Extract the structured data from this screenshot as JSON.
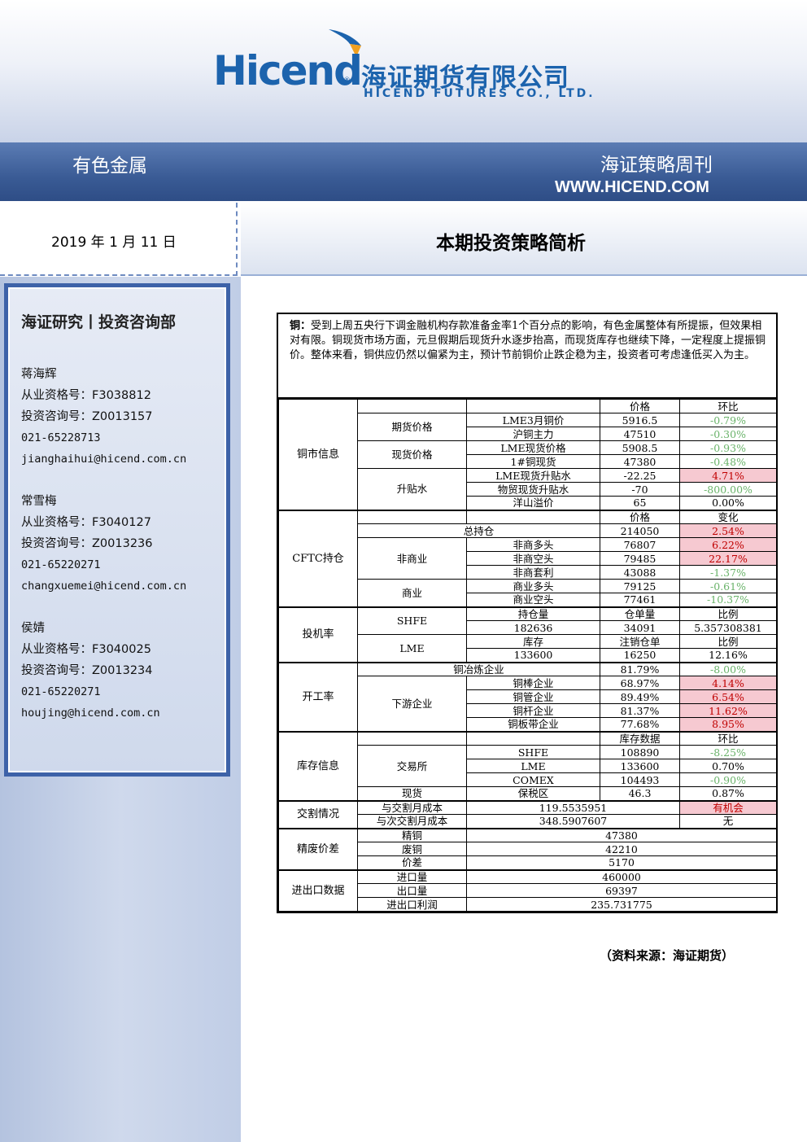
{
  "header": {
    "logo_word": "Hicend",
    "logo_tm": "®",
    "logo_cn": "海证期货有限公司",
    "logo_en": "HICEND FUTURES CO., LTD.",
    "band_left": "有色金属",
    "band_right": "海证策略周刊",
    "url": "WWW.HICEND.COM"
  },
  "date": "2019 年 1 月 11 日",
  "title": "本期投资策略简析",
  "sidebar": {
    "heading": "海证研究丨投资咨询部",
    "people": [
      {
        "name": "蒋海辉",
        "qual": "从业资格号：F3038812",
        "consult": "投资咨询号：Z0013157",
        "phone": "021-65228713",
        "email": "jianghaihui@hicend.com.cn"
      },
      {
        "name": "常雪梅",
        "qual": "从业资格号：F3040127",
        "consult": "投资咨询号：Z0013236",
        "phone": "021-65220271",
        "email": "changxuemei@hicend.com.cn"
      },
      {
        "name": "侯婧",
        "qual": "从业资格号：F3040025",
        "consult": "投资咨询号：Z0013234",
        "phone": "021-65220271",
        "email": "houjing@hicend.com.cn"
      }
    ]
  },
  "intro": {
    "label": "铜：",
    "text": "受到上周五央行下调金融机构存款准备金率1个百分点的影响，有色金属整体有所提振，但效果相对有限。铜现货市场方面，元旦假期后现货升水逐步抬高，而现货库存也继续下降，一定程度上提振铜价。整体来看，铜供应仍然以偏紧为主，预计节前铜价止跌企稳为主，投资者可考虑逢低买入为主。"
  },
  "table": {
    "copper": {
      "section": "铜市信息",
      "head_price": "价格",
      "head_change": "环比",
      "group_futures": "期货价格",
      "group_spot": "现货价格",
      "group_premium": "升贴水",
      "rows": [
        {
          "item": "LME3月铜价",
          "price": "5916.5",
          "change": "-0.79%"
        },
        {
          "item": "沪铜主力",
          "price": "47510",
          "change": "-0.30%"
        },
        {
          "item": "LME现货价格",
          "price": "5908.5",
          "change": "-0.93%"
        },
        {
          "item": "1#铜现货",
          "price": "47380",
          "change": "-0.48%"
        },
        {
          "item": "LME现货升贴水",
          "price": "-22.25",
          "change": "4.71%"
        },
        {
          "item": "物贸现货升贴水",
          "price": "-70",
          "change": "-800.00%"
        },
        {
          "item": "洋山溢价",
          "price": "65",
          "change": "0.00%"
        }
      ]
    },
    "cftc": {
      "section": "CFTC持仓",
      "head_price": "价格",
      "head_change": "变化",
      "total_label": "总持仓",
      "total_value": "214050",
      "total_change": "2.54%",
      "group_noncommercial": "非商业",
      "group_commercial": "商业",
      "rows": [
        {
          "item": "非商多头",
          "value": "76807",
          "change": "6.22%"
        },
        {
          "item": "非商空头",
          "value": "79485",
          "change": "22.17%"
        },
        {
          "item": "非商套利",
          "value": "43088",
          "change": "-1.37%"
        },
        {
          "item": "商业多头",
          "value": "79125",
          "change": "-0.61%"
        },
        {
          "item": "商业空头",
          "value": "77461",
          "change": "-10.37%"
        }
      ]
    },
    "spec": {
      "section": "投机率",
      "shfe": "SHFE",
      "lme": "LME",
      "shfe_head": [
        "持仓量",
        "仓单量",
        "比例"
      ],
      "shfe_vals": [
        "182636",
        "34091",
        "5.357308381"
      ],
      "lme_head": [
        "库存",
        "注销仓单",
        "比例"
      ],
      "lme_vals": [
        "133600",
        "16250",
        "12.16%"
      ]
    },
    "operating": {
      "section": "开工率",
      "smelter_label": "铜冶炼企业",
      "smelter_value": "81.79%",
      "smelter_change": "-8.00%",
      "group_downstream": "下游企业",
      "rows": [
        {
          "item": "铜棒企业",
          "value": "68.97%",
          "change": "4.14%"
        },
        {
          "item": "铜管企业",
          "value": "89.49%",
          "change": "6.54%"
        },
        {
          "item": "铜杆企业",
          "value": "81.37%",
          "change": "11.62%"
        },
        {
          "item": "铜板带企业",
          "value": "77.68%",
          "change": "8.95%"
        }
      ]
    },
    "inventory": {
      "section": "库存信息",
      "head_value": "库存数据",
      "head_change": "环比",
      "group_exchange": "交易所",
      "group_spot": "现货",
      "rows": [
        {
          "item": "SHFE",
          "value": "108890",
          "change": "-8.25%"
        },
        {
          "item": "LME",
          "value": "133600",
          "change": "0.70%"
        },
        {
          "item": "COMEX",
          "value": "104493",
          "change": "-0.90%"
        },
        {
          "item": "保税区",
          "value": "46.3",
          "change": "0.87%"
        }
      ]
    },
    "delivery": {
      "section": "交割情况",
      "rows": [
        {
          "item": "与交割月成本",
          "value": "119.5535951",
          "note": "有机会"
        },
        {
          "item": "与次交割月成本",
          "value": "348.5907607",
          "note": "无"
        }
      ]
    },
    "scrap": {
      "section": "精废价差",
      "rows": [
        {
          "item": "精铜",
          "value": "47380"
        },
        {
          "item": "废铜",
          "value": "42210"
        },
        {
          "item": "价差",
          "value": "5170"
        }
      ]
    },
    "trade": {
      "section": "进出口数据",
      "rows": [
        {
          "item": "进口量",
          "value": "460000"
        },
        {
          "item": "出口量",
          "value": "69397"
        },
        {
          "item": "进出口利润",
          "value": "235.731775"
        }
      ]
    }
  },
  "source": "（资料来源：海证期货）"
}
